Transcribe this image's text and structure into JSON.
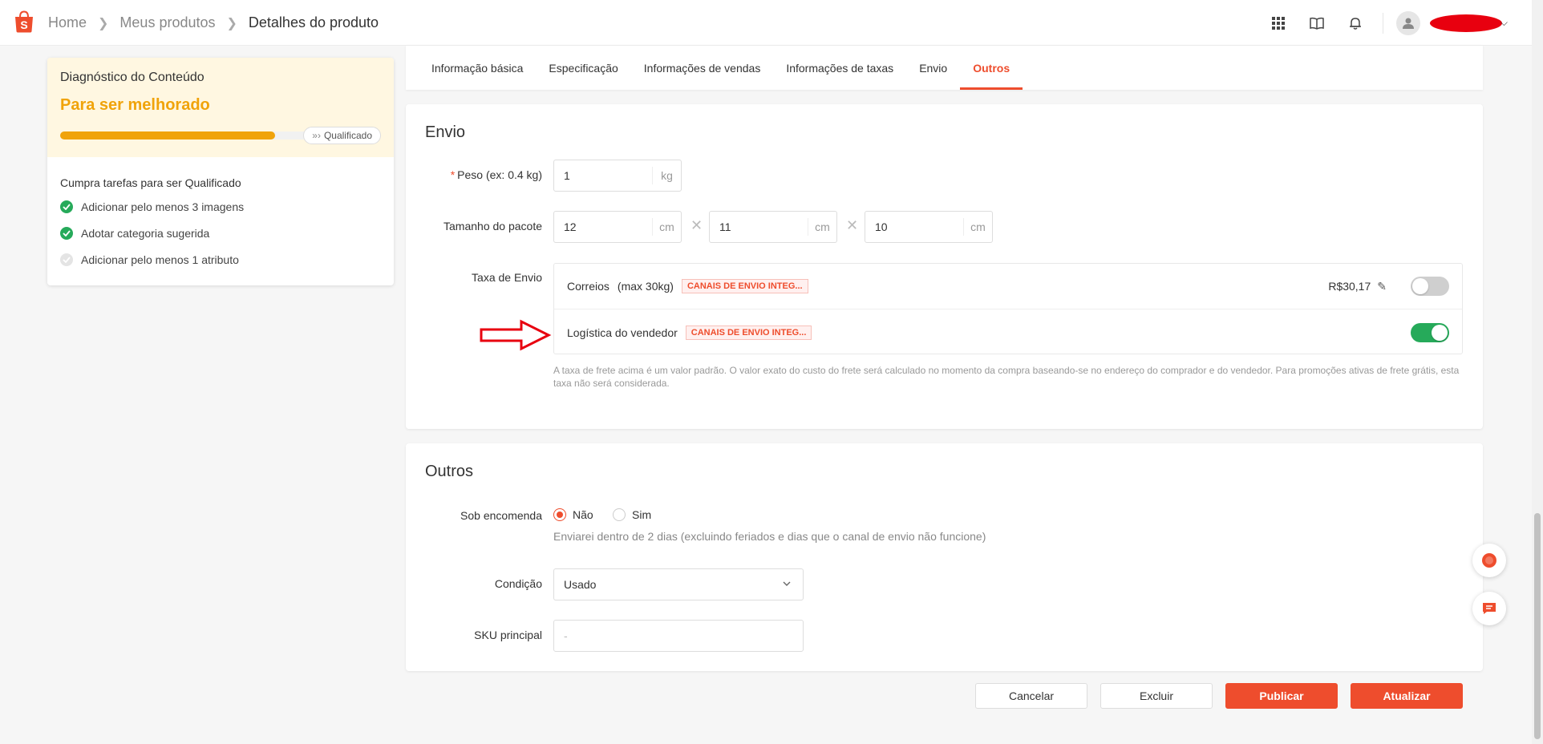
{
  "breadcrumb": {
    "home": "Home",
    "products": "Meus produtos",
    "current": "Detalhes do produto"
  },
  "header": {
    "icons": [
      "apps-grid-icon",
      "book-icon",
      "bell-icon",
      "avatar-icon"
    ]
  },
  "diagnostic": {
    "title": "Diagnóstico do Conteúdo",
    "status": "Para ser melhorado",
    "progress_percent": 67,
    "badge": "Qualificado",
    "subtitle": "Cumpra tarefas para ser Qualificado",
    "tasks": [
      {
        "label": "Adicionar pelo menos 3 imagens",
        "done": true
      },
      {
        "label": "Adotar categoria sugerida",
        "done": true
      },
      {
        "label": "Adicionar pelo menos 1 atributo",
        "done": false
      }
    ]
  },
  "tabs": [
    "Informação básica",
    "Especificação",
    "Informações de vendas",
    "Informações de taxas",
    "Envio",
    "Outros"
  ],
  "active_tab": "Outros",
  "envio": {
    "title": "Envio",
    "weight_label": "Peso (ex: 0.4 kg)",
    "weight_value": "1",
    "weight_unit": "kg",
    "package_label": "Tamanho do pacote",
    "dims": [
      {
        "value": "12",
        "unit": "cm"
      },
      {
        "value": "11",
        "unit": "cm"
      },
      {
        "value": "10",
        "unit": "cm"
      }
    ],
    "times_symbol": "✕",
    "fee_label": "Taxa de Envio",
    "carriers": [
      {
        "name": "Correios",
        "max": "(max 30kg)",
        "tag": "CANAIS DE ENVIO INTEG...",
        "price": "R$30,17",
        "enabled": false
      },
      {
        "name": "Logística do vendedor",
        "tag": "CANAIS DE ENVIO INTEG...",
        "enabled": true
      }
    ],
    "note": "A taxa de frete acima é um valor padrão. O valor exato do custo do frete será calculado no momento da compra baseando-se no endereço do comprador e do vendedor. Para promoções ativas de frete grátis, esta taxa não será considerada."
  },
  "outros": {
    "title": "Outros",
    "preorder_label": "Sob encomenda",
    "options": [
      "Não",
      "Sim"
    ],
    "selected": "Não",
    "preorder_hint": "Enviarei dentro de 2 dias (excluindo feriados e dias que o canal de envio não funcione)",
    "condition_label": "Condição",
    "condition_value": "Usado",
    "sku_label": "SKU principal",
    "sku_placeholder": "-"
  },
  "buttons": {
    "cancel": "Cancelar",
    "delete": "Excluir",
    "publish": "Publicar",
    "update": "Atualizar"
  },
  "colors": {
    "accent": "#ee4d2d",
    "warning": "#f0a30a",
    "success": "#26aa5a"
  }
}
